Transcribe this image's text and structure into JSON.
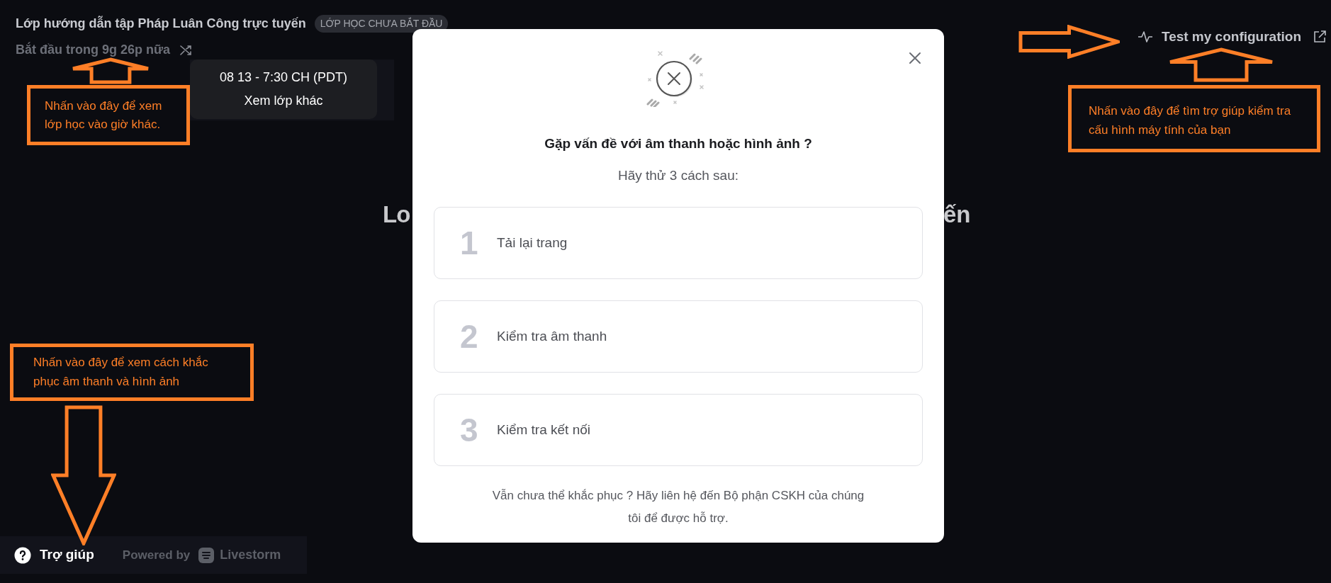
{
  "header": {
    "title": "Lớp hướng dẫn tập Pháp Luân Công trực tuyến",
    "status_badge": "LỚP HỌC CHƯA BẮT ĐẦU",
    "countdown": "Bắt đầu trong 9g 26p nữa"
  },
  "schedule_tooltip": {
    "time": "08 13 - 7:30 CH (PDT)",
    "link": "Xem lớp khác"
  },
  "test_config": {
    "label": "Test my configuration"
  },
  "background_heading": {
    "left_fragment": "Lo",
    "right_fragment": "ến"
  },
  "footer": {
    "help": "Trợ giúp",
    "powered_by": "Powered by",
    "brand": "Livestorm"
  },
  "modal": {
    "title": "Gặp vấn đề với âm thanh hoặc hình ảnh ?",
    "subtitle": "Hãy thử 3 cách sau:",
    "steps": [
      {
        "number": "1",
        "label": "Tải lại trang"
      },
      {
        "number": "2",
        "label": "Kiểm tra âm thanh"
      },
      {
        "number": "3",
        "label": "Kiểm tra kết nối"
      }
    ],
    "footer_note": "Vẫn chưa thể khắc phục ? Hãy liên hệ đến Bộ phận CSKH của chúng tôi để được hỗ trợ."
  },
  "annotations": [
    {
      "text": "Nhấn vào đây để xem lớp học vào giờ khác.",
      "arrows": [
        {
          "kind": "up"
        }
      ]
    },
    {
      "text": "Nhấn vào đây để tìm trợ giúp kiểm tra cấu hình máy tính của bạn",
      "arrows": [
        {
          "kind": "right"
        },
        {
          "kind": "up"
        }
      ]
    },
    {
      "text": "Nhấn vào đây để xem cách khắc phục âm thanh và hình ảnh",
      "arrows": [
        {
          "kind": "down"
        }
      ]
    }
  ]
}
